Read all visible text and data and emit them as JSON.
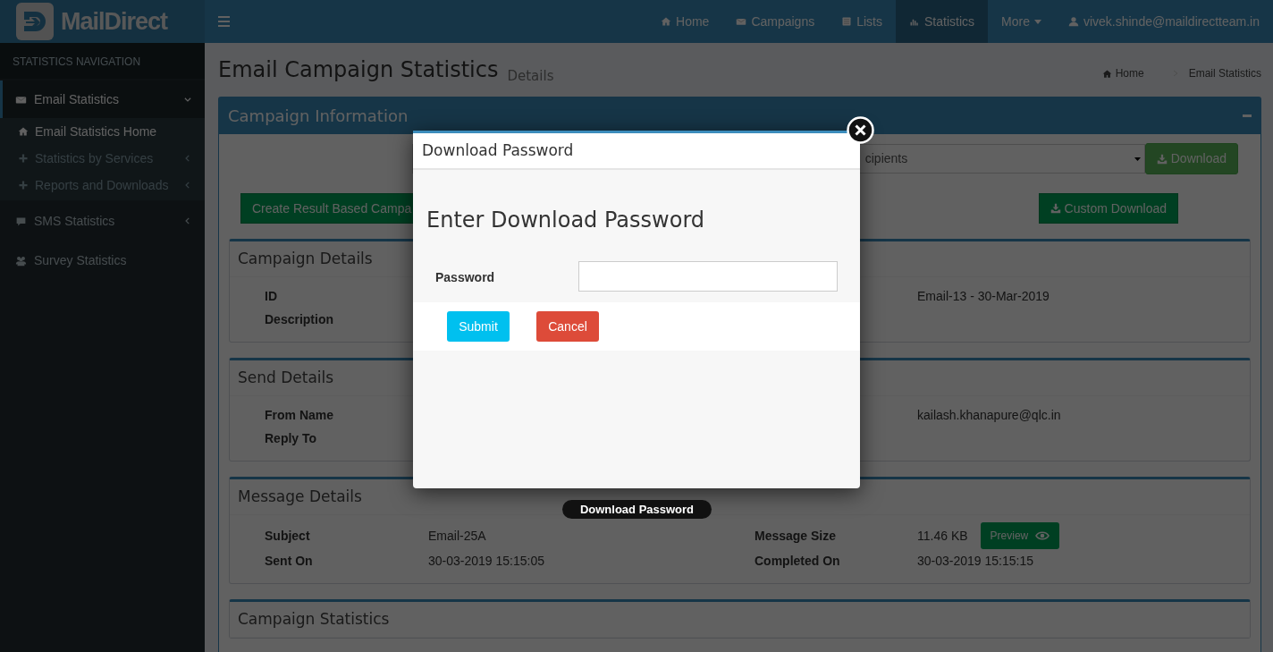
{
  "navbar": {
    "logo_text": "MailDirect",
    "items": [
      {
        "label": "Home",
        "selected": false,
        "kind": "link"
      },
      {
        "label": "Campaigns",
        "selected": false,
        "kind": "link"
      },
      {
        "label": "Lists",
        "selected": false,
        "kind": "link"
      },
      {
        "label": "Statistics",
        "selected": true,
        "kind": "link"
      },
      {
        "label": "More",
        "selected": false,
        "kind": "dropdown"
      },
      {
        "label": "vivek.shinde@maildirectteam.in",
        "selected": false,
        "kind": "link"
      }
    ]
  },
  "sidebar": {
    "header": "STATISTICS NAVIGATION",
    "items": [
      {
        "label": "Email Statistics",
        "kind": "treeview",
        "selected": true,
        "expanded": true,
        "children": [
          {
            "label": "Email Statistics Home",
            "kind": "link",
            "selected": true
          },
          {
            "label": "Statistics by Services",
            "kind": "treeview",
            "selected": false,
            "expanded": false
          },
          {
            "label": "Reports and Downloads",
            "kind": "treeview",
            "selected": false,
            "expanded": false
          }
        ]
      },
      {
        "label": "SMS Statistics",
        "kind": "treeview",
        "selected": false,
        "expanded": false
      },
      {
        "label": "Survey Statistics",
        "kind": "link",
        "selected": false
      }
    ]
  },
  "page": {
    "title": "Email Campaign Statistics",
    "subtitle": "Details",
    "breadcrumb": [
      {
        "label": "Home"
      },
      {
        "label": "Email Statistics"
      }
    ]
  },
  "campaign_box": {
    "title": "Campaign Information",
    "select_value": "cipients",
    "download_button": "Download",
    "create_button": "Create Result Based Campa",
    "custom_download_button": "Custom Download"
  },
  "sections": [
    {
      "title": "Campaign Details",
      "rows": [
        {
          "label": "ID",
          "value_2": "Email-13 - 30-Mar-2019"
        },
        {
          "label": "Description"
        }
      ]
    },
    {
      "title": "Send Details",
      "rows": [
        {
          "label": "From Name",
          "value_2": "kailash.khanapure@qlc.in"
        },
        {
          "label": "Reply To"
        }
      ]
    },
    {
      "title": "Message Details",
      "rows": [
        {
          "label": "Subject",
          "value": "Email-25A",
          "label_2": "Message Size",
          "value_2": "11.46 KB",
          "button": "Preview"
        },
        {
          "label": "Sent On",
          "value": "30-03-2019 15:15:05",
          "label_2": "Completed On",
          "value_2": "30-03-2019 15:15:15"
        }
      ]
    },
    {
      "title": "Campaign Statistics"
    }
  ],
  "modal": {
    "title": "Download Password",
    "heading": "Enter Download Password",
    "field_label": "Password",
    "buttons": [
      {
        "label": "Submit",
        "kind": "primary"
      },
      {
        "label": "Cancel",
        "kind": "danger"
      }
    ]
  },
  "tooltip": "Download Password"
}
